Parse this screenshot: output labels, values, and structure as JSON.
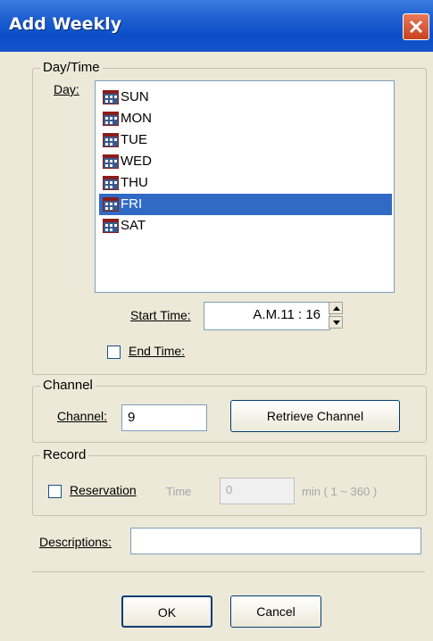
{
  "window": {
    "title": "Add Weekly"
  },
  "daytime": {
    "group_label": "Day/Time",
    "day_label": "Day:",
    "days": [
      {
        "label": "SUN",
        "selected": false
      },
      {
        "label": "MON",
        "selected": false
      },
      {
        "label": "TUE",
        "selected": false
      },
      {
        "label": "WED",
        "selected": false
      },
      {
        "label": "THU",
        "selected": false
      },
      {
        "label": "FRI",
        "selected": true
      },
      {
        "label": "SAT",
        "selected": false
      }
    ],
    "start_time_label": "Start Time:",
    "start_time_value": "A.M.11 : 16",
    "end_time_label": "End Time:",
    "end_time_checked": false
  },
  "channel": {
    "group_label": "Channel",
    "channel_label": "Channel:",
    "channel_value": "9",
    "retrieve_button": "Retrieve Channel"
  },
  "record": {
    "group_label": "Record",
    "reservation_label": "Reservation",
    "reservation_checked": false,
    "time_label": "Time",
    "time_value": "0",
    "range_label": "min ( 1 ~ 360 )"
  },
  "descriptions": {
    "label": "Descriptions:",
    "value": ""
  },
  "buttons": {
    "ok": "OK",
    "cancel": "Cancel"
  },
  "colors": {
    "title_bar": "#0a4ec8",
    "selection": "#316ac5",
    "dialog_bg": "#ece9d8"
  }
}
